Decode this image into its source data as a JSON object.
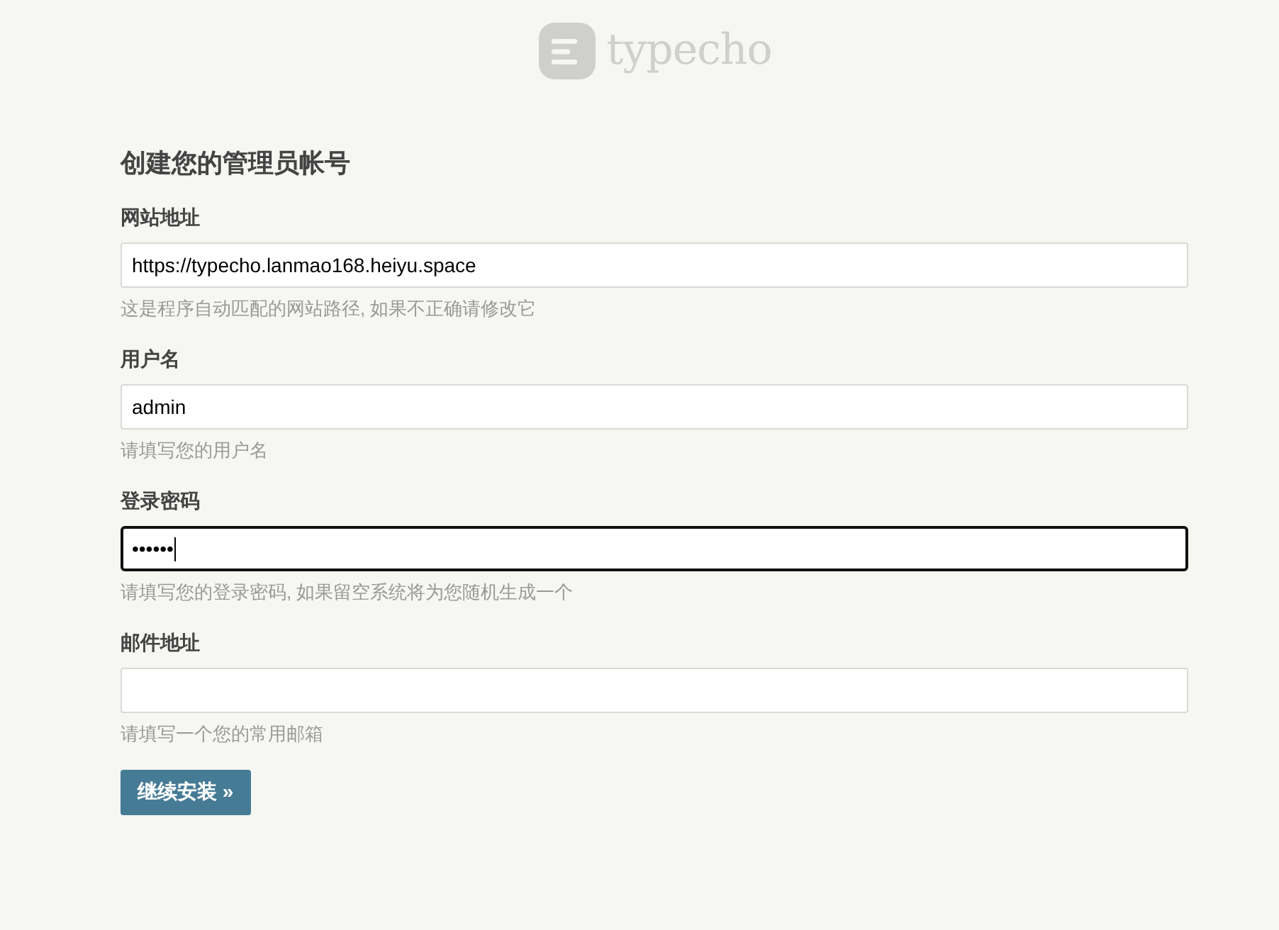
{
  "logo": {
    "text": "typecho"
  },
  "heading": "创建您的管理员帐号",
  "fields": [
    {
      "label": "网站地址",
      "value": "https://typecho.lanmao168.heiyu.space",
      "hint": "这是程序自动匹配的网站路径, 如果不正确请修改它",
      "focused": false
    },
    {
      "label": "用户名",
      "value": "admin",
      "hint": "请填写您的用户名",
      "focused": false
    },
    {
      "label": "登录密码",
      "value": "••••••",
      "hint": "请填写您的登录密码, 如果留空系统将为您随机生成一个",
      "focused": true
    },
    {
      "label": "邮件地址",
      "hint": "请填写一个您的常用邮箱",
      "focused": false
    }
  ],
  "button": {
    "label": "继续安装 »"
  }
}
